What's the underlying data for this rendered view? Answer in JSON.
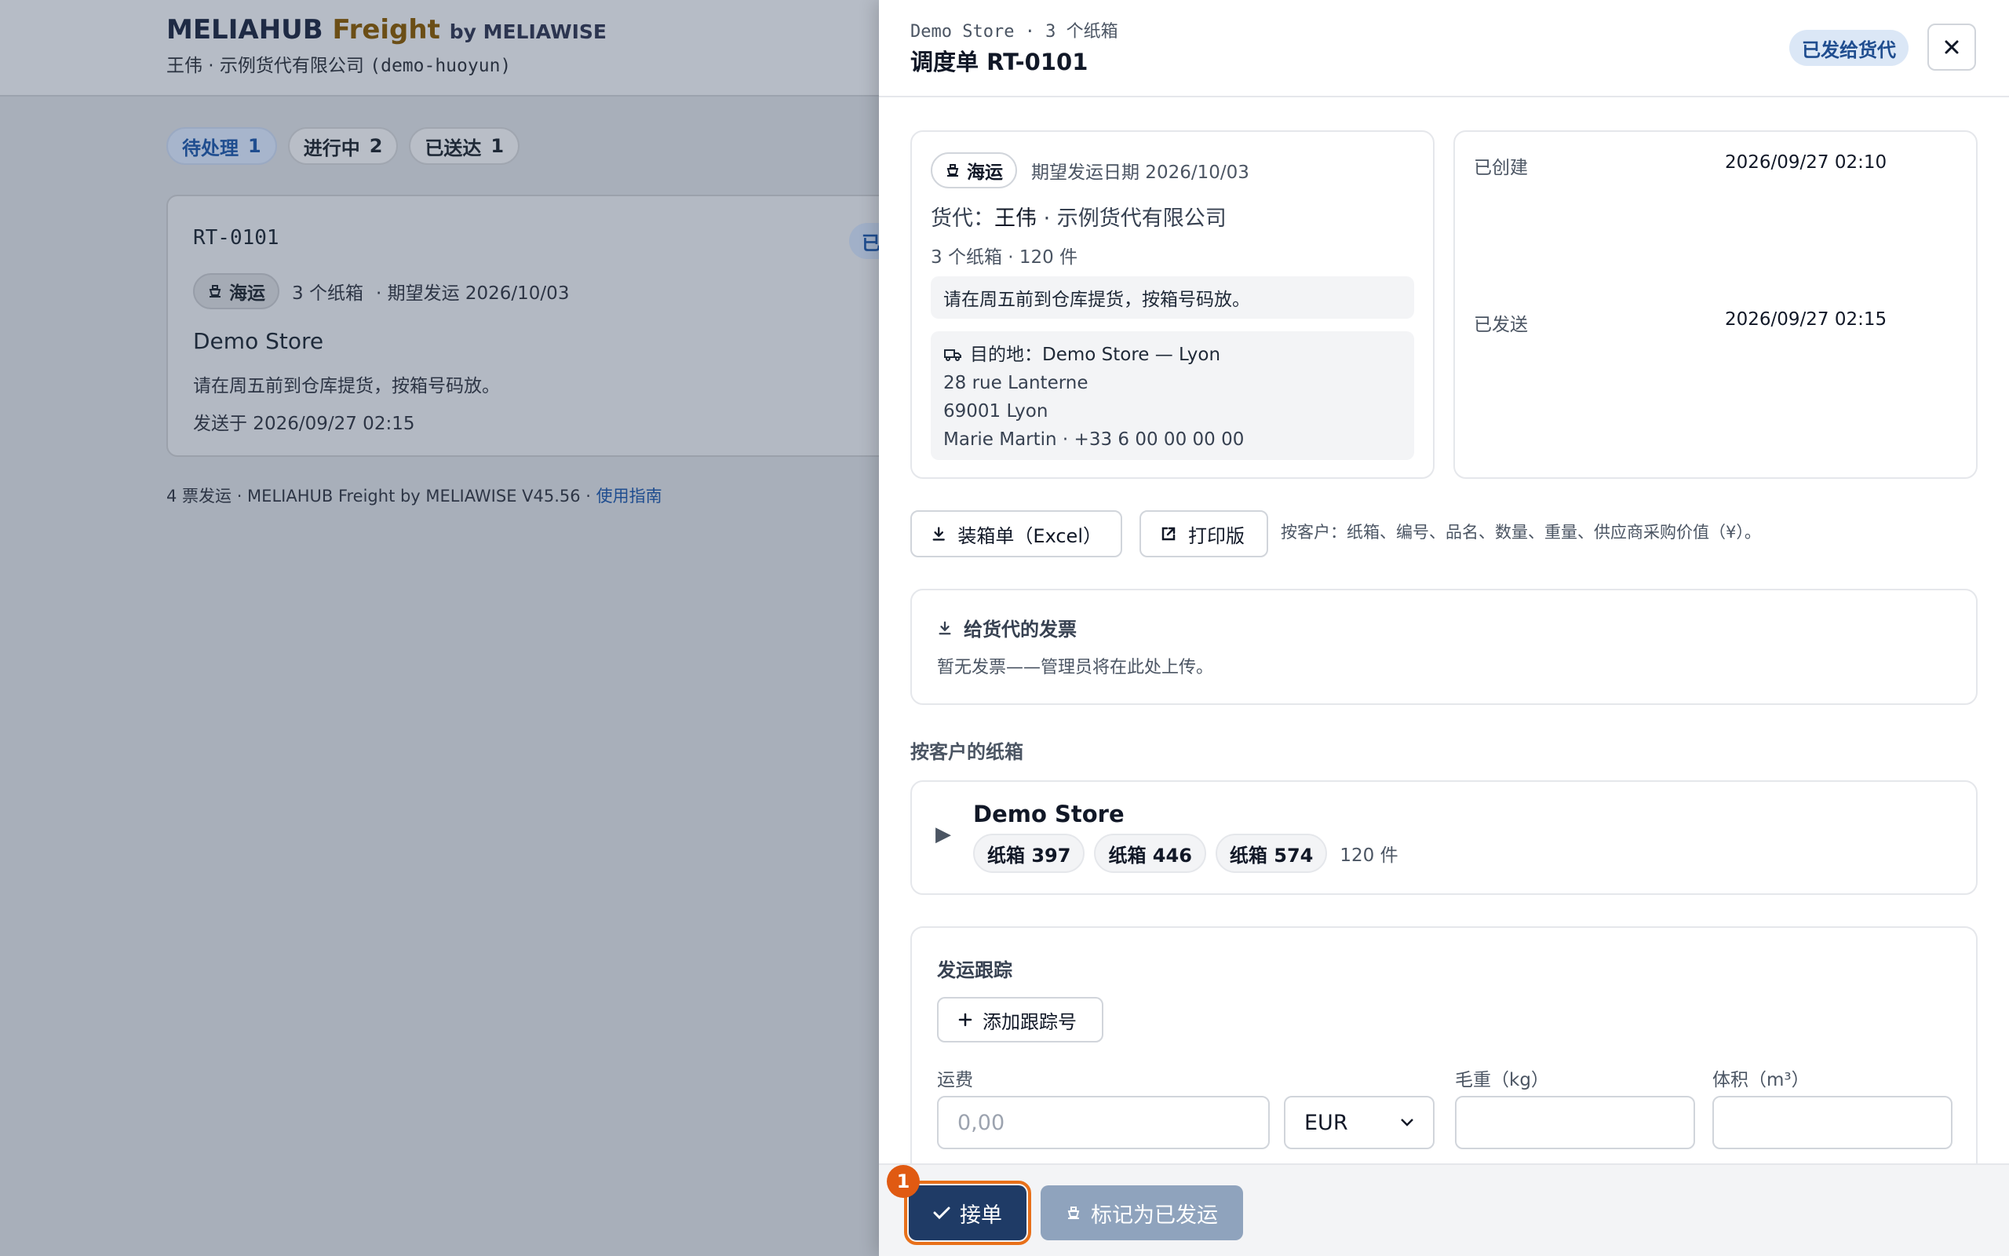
{
  "background": {
    "brand": {
      "name": "MELIAHUB",
      "freight": "Freight",
      "by": "by MELIAWISE"
    },
    "user_line": "王伟 · 示例货代有限公司",
    "user_code": "(demo-huoyun)",
    "tabs": [
      {
        "label": "待处理",
        "count": "1"
      },
      {
        "label": "进行中",
        "count": "2"
      },
      {
        "label": "已送达",
        "count": "1"
      }
    ],
    "card": {
      "ref": "RT-0101",
      "badge": "已",
      "mode": "海运",
      "boxes": "3 个纸箱",
      "expected": "· 期望发运 2026/10/03",
      "store": "Demo Store",
      "note": "请在周五前到仓库提货，按箱号码放。",
      "sent": "发送于 2026/09/27 02:15"
    },
    "footer": {
      "text": "4 票发运 · MELIAHUB Freight by MELIAWISE V45.56 ·",
      "link": "使用指南"
    }
  },
  "panel": {
    "subtitle": "Demo Store · 3 个纸箱",
    "title": "调度单 RT-0101",
    "status": "已发给货代",
    "info": {
      "mode": "海运",
      "expected": "期望发运日期 2026/10/03",
      "forwarder_prefix": "货代：",
      "forwarder_name": "王伟",
      "forwarder_company": " · 示例货代有限公司",
      "counts": "3 个纸箱 · 120 件",
      "note": "请在周五前到仓库提货，按箱号码放。",
      "destination": "目的地：Demo Store — Lyon",
      "address1": "28 rue Lanterne",
      "address2": "69001 Lyon",
      "contact": "Marie Martin · +33 6 00 00 00 00"
    },
    "timeline": [
      {
        "label": "已创建",
        "value": "2026/09/27 02:10"
      },
      {
        "label": "已发送",
        "value": "2026/09/27 02:15"
      }
    ],
    "actions": {
      "excel": "装箱单（Excel）",
      "print": "打印版",
      "hint": "按客户：纸箱、编号、品名、数量、重量、供应商采购价值（¥）。"
    },
    "invoice": {
      "title": "给货代的发票",
      "text": "暂无发票——管理员将在此处上传。"
    },
    "customers_label": "按客户的纸箱",
    "customer": {
      "name": "Demo Store",
      "boxes": [
        "纸箱 397",
        "纸箱 446",
        "纸箱 574"
      ],
      "pieces": "120 件"
    },
    "tracking": {
      "title": "发运跟踪",
      "add_button": "添加跟踪号",
      "freight_label": "运费",
      "freight_placeholder": "0,00",
      "currency": "EUR",
      "weight_label": "毛重（kg）",
      "volume_label": "体积（m³）"
    },
    "footer": {
      "marker": "1",
      "accept": "接单",
      "mark_shipped": "标记为已发运"
    }
  }
}
